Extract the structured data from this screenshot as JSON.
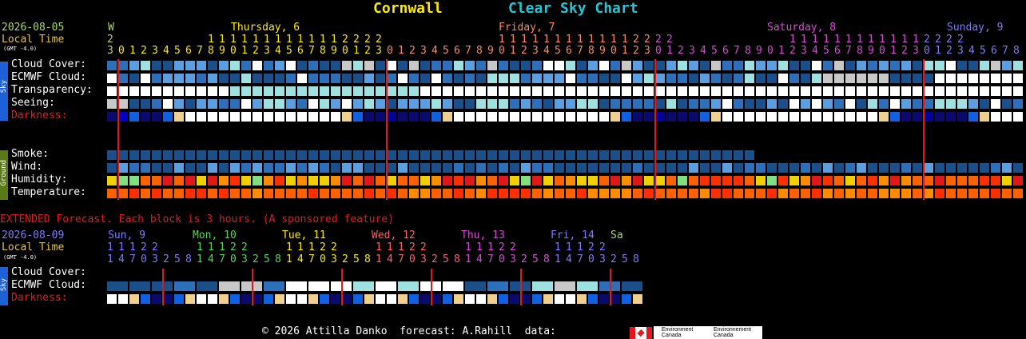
{
  "header": {
    "site": "Cornwall",
    "title": "Clear Sky Chart",
    "site_color": "#ffea00",
    "title_color": "#1ec8d8"
  },
  "main": {
    "date": "2026-08-05",
    "local_time": "Local Time",
    "gmt": "(GMT -4.0)",
    "days": [
      {
        "text": "W",
        "color": "#a9d86e"
      },
      {
        "text": "Thursday, 6",
        "color": "#ffea00"
      },
      {
        "text": "Friday, 7",
        "color": "#ff8a5c"
      },
      {
        "text": "Saturday, 8",
        "color": "#d948d9"
      },
      {
        "text": "Sunday, 9",
        "color": "#7b7bff"
      }
    ],
    "hours_top": "2                 1 1 1 1 1 1 1 1 1 1 1 1 2 2 2 2                     1 1 1 1 1 1 1 1 1 1 1 1 2 2 2 2                     1 1 1 1 1 1 1 1 1 1 1 1 2 2 2 2",
    "hours_bot": "3 0 1 2 3 4 5 6 7 8 9 0 1 2 3 4 5 6 7 8 9 0 1 2 3 0 1 2 3 4 5 6 7 8 9 0 1 2 3 4 5 6 7 8 9 0 1 2 3 0 1 2 3 4 5 6 7 8 9 0 1 2 3 4 5 6 7 8 9 0 1 2 3 0 1 2 3 4 5 6 7 8",
    "sky_rows": [
      {
        "label": "Cloud Cover:",
        "color": "#ffffff"
      },
      {
        "label": "ECMWF Cloud:",
        "color": "#ffffff"
      },
      {
        "label": "Transparency:",
        "color": "#ffffff"
      },
      {
        "label": "Seeing:",
        "color": "#ffffff"
      },
      {
        "label": "Darkness:",
        "color": "#e8161a"
      }
    ],
    "ground_rows": [
      {
        "label": "Smoke:"
      },
      {
        "label": "Wind:"
      },
      {
        "label": "Humidity:"
      },
      {
        "label": "Temperature:"
      }
    ],
    "sky_tab": "Sky",
    "ground_tab": "Ground"
  },
  "extended": {
    "note": "EXTENDED Forecast. Each block is 3 hours. (A sponsored feature)",
    "date": "2026-08-09",
    "local_time": "Local Time",
    "gmt": "(GMT -4.0)",
    "days": [
      {
        "text": "Sun, 9",
        "color": "#7b7bff"
      },
      {
        "text": "Mon, 10",
        "color": "#52d852"
      },
      {
        "text": "Tue, 11",
        "color": "#ffea00"
      },
      {
        "text": "Wed, 12",
        "color": "#ff6060"
      },
      {
        "text": "Thu, 13",
        "color": "#d948d9"
      },
      {
        "text": "Fri, 14",
        "color": "#7b7bff"
      },
      {
        "text": "Sa",
        "color": "#a9d86e"
      }
    ],
    "hours_top": "1 1 1 2 2       1 1 1 2 2       1 1 1 2 2       1 1 1 2 2       1 1 1 2 2       1 1 1 2 2",
    "hours_bot": "1 4 7 0 3 2 5 8 1 4 7 0 3 2 5 8 1 4 7 0 3 2 5 8 1 4 7 0 3 2 5 8 1 4 7 0 3 2 5 8 1 4 7 0 3 2 5 8",
    "rows": [
      {
        "label": "Cloud Cover:",
        "color": "#ffffff"
      },
      {
        "label": "ECMWF Cloud:",
        "color": "#ffffff"
      },
      {
        "label": "Darkness:",
        "color": "#e8161a"
      }
    ],
    "sky_tab": "Sky"
  },
  "footer": {
    "copyright": "© 2026 Attilla Danko  forecast: A.Rahill  data:",
    "env_en": "Environment Canada",
    "env_fr": "Environnement Canada"
  }
}
